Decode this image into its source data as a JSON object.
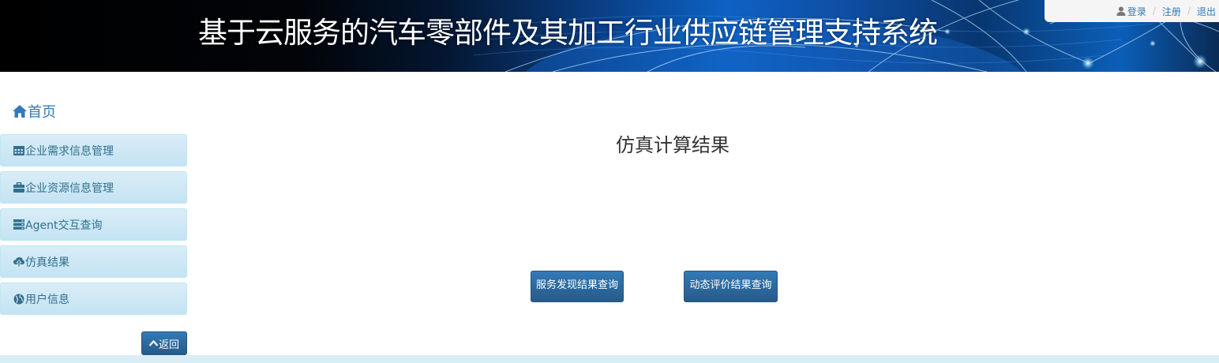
{
  "header": {
    "title": "基于云服务的汽车零部件及其加工行业供应链管理支持系统",
    "background_colors": [
      "#000000",
      "#0d62c4"
    ]
  },
  "userbar": {
    "login": "登录",
    "register": "注册",
    "logout": "退出",
    "separator": "/"
  },
  "sidebar": {
    "home_label": "首页",
    "items": [
      {
        "label": "企业需求信息管理",
        "icon": "calendar-icon"
      },
      {
        "label": "企业资源信息管理",
        "icon": "briefcase-icon"
      },
      {
        "label": "Agent交互查询",
        "icon": "server-icon"
      },
      {
        "label": "仿真结果",
        "icon": "cloud-upload-icon"
      },
      {
        "label": "用户信息",
        "icon": "globe-icon"
      }
    ],
    "back_label": "返回"
  },
  "main": {
    "title": "仿真计算结果",
    "buttons": [
      "服务发现结果查询",
      "动态评价结果查询"
    ]
  },
  "colors": {
    "link": "#337ab7",
    "menu_bg": "#d9edf7",
    "menu_text": "#31708f",
    "primary_button": "#286090",
    "footer_strip": "#d9edf7"
  }
}
